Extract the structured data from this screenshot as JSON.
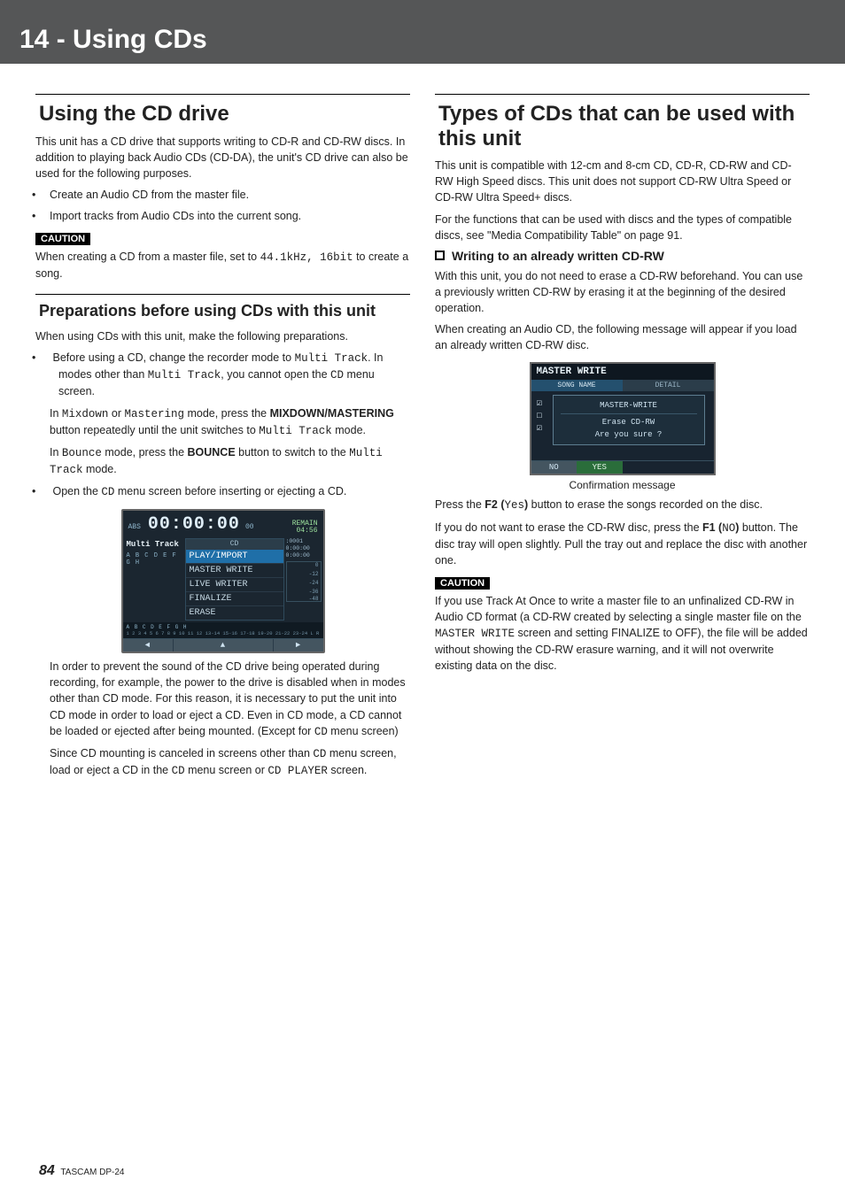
{
  "banner": {
    "title": "14 - Using CDs"
  },
  "left": {
    "h1": "Using the CD drive",
    "intro": "This unit has a CD drive that supports writing to CD-R and CD-RW discs. In addition to playing back Audio CDs (CD-DA), the unit's CD drive can also be used for the following purposes.",
    "bul1": "Create an Audio CD from the master file.",
    "bul2": "Import tracks from Audio CDs into the current song.",
    "caution_label": "CAUTION",
    "caution1a": "When creating a CD from a master file, set to ",
    "caution1b": "44.1kHz, 16bit",
    "caution1c": " to create a song.",
    "h2": "Preparations before using CDs with this unit",
    "prep_intro": "When using CDs with this unit, make the following preparations.",
    "li1a": "Before using a CD, change the recorder mode to ",
    "li1b": "Multi Track",
    "li1c": ". In modes other than ",
    "li1d": "Multi Track",
    "li1e": ", you cannot open the ",
    "li1f": "CD",
    "li1g": " menu screen.",
    "li1_sub1a": "In ",
    "li1_sub1b": "Mixdown",
    "li1_sub1c": " or ",
    "li1_sub1d": "Mastering",
    "li1_sub1e": " mode, press the ",
    "li1_sub1f": "MIXDOWN/MASTERING",
    "li1_sub1g": " button repeatedly until the unit switches to ",
    "li1_sub1h": "Multi Track",
    "li1_sub1i": " mode.",
    "li1_sub2a": "In ",
    "li1_sub2b": "Bounce",
    "li1_sub2c": " mode, press the ",
    "li1_sub2d": "BOUNCE",
    "li1_sub2e": " button to switch to the ",
    "li1_sub2f": "Multi Track",
    "li1_sub2g": " mode.",
    "li2a": "Open the ",
    "li2b": "CD",
    "li2c": " menu screen before inserting or ejecting a CD.",
    "shot1": {
      "abs": "ABS",
      "time": "00:00:00",
      "ms": "00",
      "remain_lbl": "REMAIN",
      "remain_val": "04:56",
      "mt": "Multi Track",
      "letters": "A B C D E F G H",
      "menu_hdr": "CD",
      "m1": "PLAY/IMPORT",
      "m2": "MASTER WRITE",
      "m3": "LIVE WRITER",
      "m4": "FINALIZE",
      "m5": "ERASE",
      "t1": ":0001",
      "t2": "0:00:00",
      "t3": "0:00:00",
      "mt0": "0",
      "mt12": "-12",
      "mt24": "-24",
      "mt36": "-36",
      "mt48": "-48",
      "btm_letters": "A B C D E F G H",
      "btm_nums": "1 2 3 4 5 6 7 8 9 10 11 12 13-14 15-16 17-18 19-20 21-22 23-24   L R",
      "nav_l": "◄",
      "nav_m": "▲",
      "nav_r": "►"
    },
    "after1a": "In order to prevent the sound of the CD drive being operated during recording, for example, the power to the drive is disabled when in modes other than CD mode. For this reason, it is necessary to put the unit into CD mode in order to load or eject a CD. Even in CD mode, a CD cannot be loaded or ejected after being mounted. (Except for ",
    "after1b": "CD",
    "after1c": " menu screen)",
    "after2a": "Since CD mounting is canceled in screens other than ",
    "after2b": "CD",
    "after2c": " menu screen, load or eject a CD in the ",
    "after2d": "CD",
    "after2e": " menu screen or ",
    "after2f": "CD PLAYER",
    "after2g": " screen."
  },
  "right": {
    "h1": "Types of CDs that can be used with this unit",
    "p1": "This unit is compatible with 12-cm and 8-cm CD, CD-R, CD-RW and CD-RW High Speed discs. This unit does not support CD-RW Ultra Speed or CD-RW Ultra Speed+ discs.",
    "p2": "For the functions that can be used with discs and the types of compatible discs, see \"Media Compatibility Table\" on page 91.",
    "h3": "Writing to an already written CD-RW",
    "p3": "With this unit, you do not need to erase a CD-RW beforehand. You can use a previously written CD-RW by erasing it at the beginning of the desired operation.",
    "p4": "When creating an Audio CD, the following message will appear if you load an already written CD-RW disc.",
    "shot2": {
      "title": "MASTER WRITE",
      "tab1": "SONG NAME",
      "tab2": "DETAIL",
      "d1": "MASTER-WRITE",
      "d2": "Erase CD-RW",
      "d3": "Are you sure ?",
      "no": "NO",
      "yes": "YES"
    },
    "caption": "Confirmation message",
    "p5a": "Press the ",
    "p5b": "F2 (",
    "p5c": "Yes",
    "p5d": ")",
    "p5e": " button to erase the songs recorded on the disc.",
    "p6a": "If you do not want to erase the CD-RW disc, press the ",
    "p6b": "F1 (",
    "p6c": "NO",
    "p6d": ")",
    "p6e": " button. The disc tray will open slightly. Pull the tray out and replace the disc with another one.",
    "caution_label": "CAUTION",
    "c1a": "If you use Track At Once to write a master file to an unfinalized CD-RW in Audio CD format (a CD-RW created by selecting a single master file on the ",
    "c1b": "MASTER WRITE",
    "c1c": " screen and setting FINALIZE to OFF), the file will be added without showing the CD-RW erasure warning, and it will not overwrite existing data on the disc."
  },
  "footer": {
    "page": "84",
    "model": "TASCAM DP-24"
  }
}
